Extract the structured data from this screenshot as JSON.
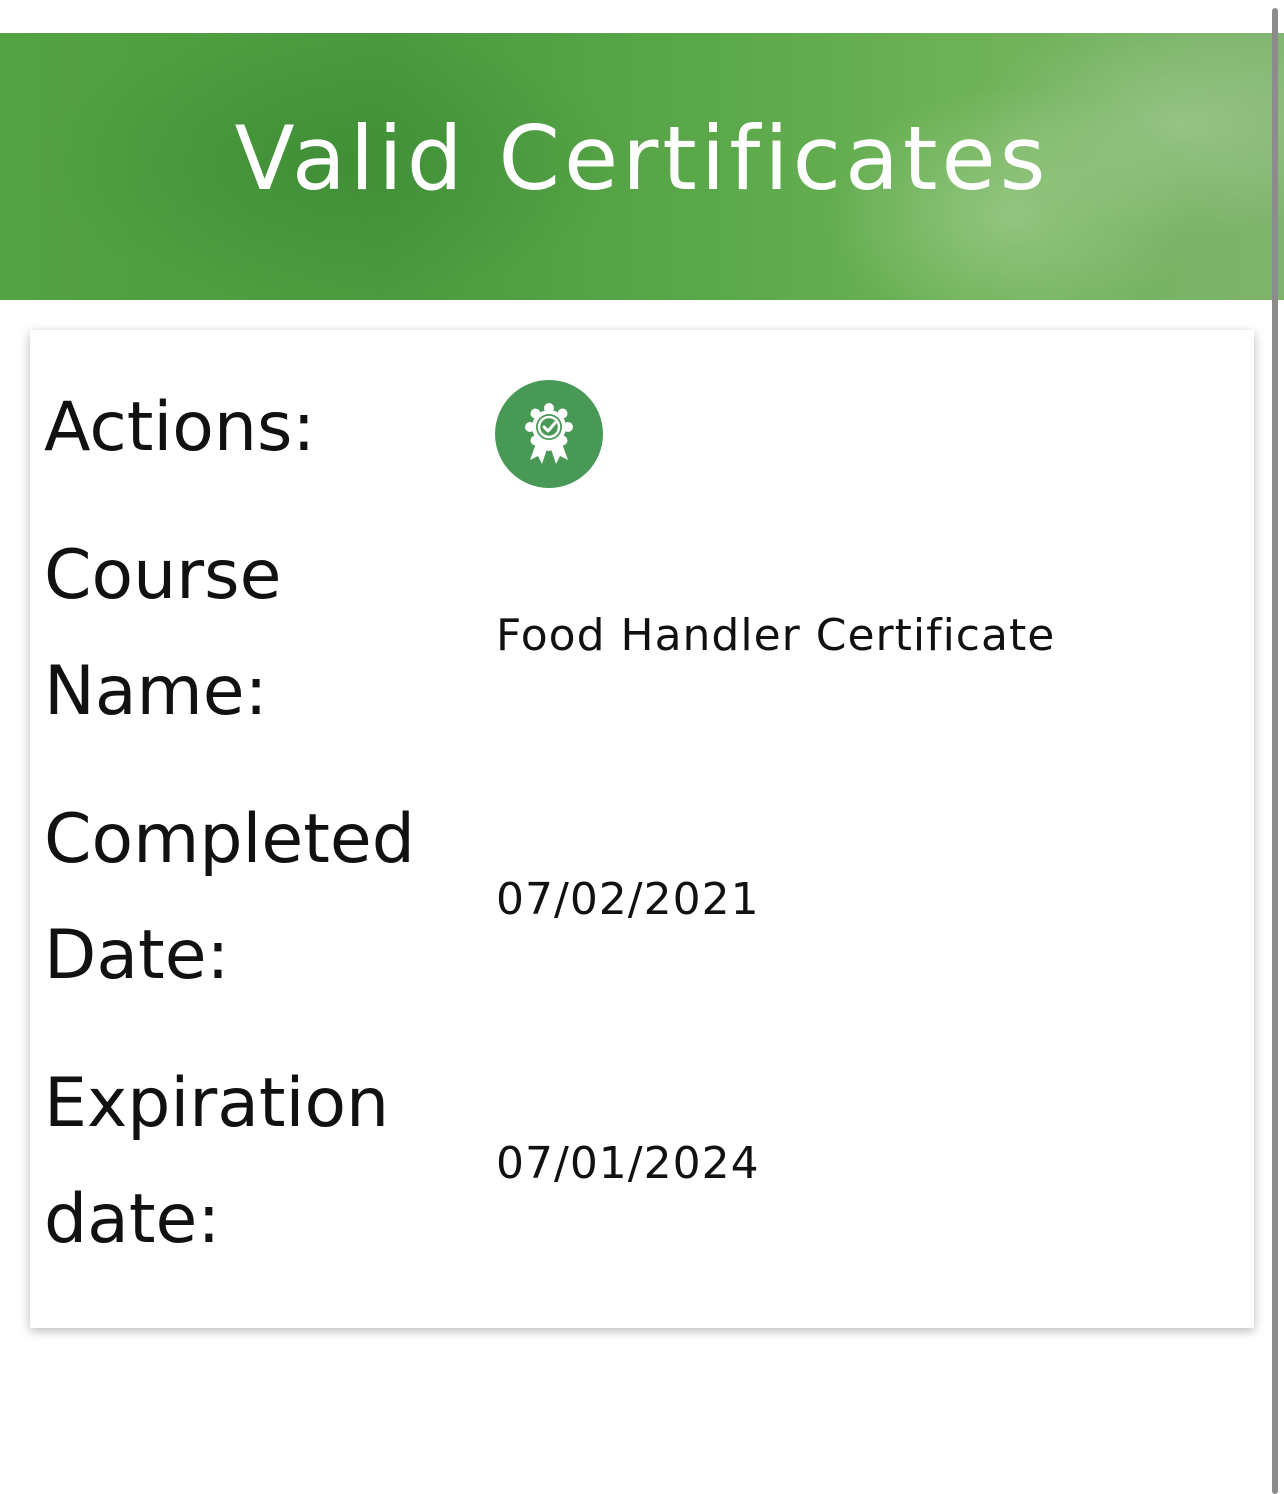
{
  "header": {
    "title": "Valid Certificates"
  },
  "certificate": {
    "actions_label": "Actions:",
    "action_icon": "award-badge-icon",
    "course_name_label_line1": "Course",
    "course_name_label_line2": "Name:",
    "course_name": "Food Handler Certificate",
    "completed_label_line1": "Completed",
    "completed_label_line2": "Date:",
    "completed_date": "07/02/2021",
    "expiration_label_line1": "Expiration",
    "expiration_label_line2": "date:",
    "expiration_date": "07/01/2024"
  },
  "colors": {
    "header_green": "#4c9a3e",
    "action_button": "#479955",
    "header_text": "#ffffff"
  }
}
